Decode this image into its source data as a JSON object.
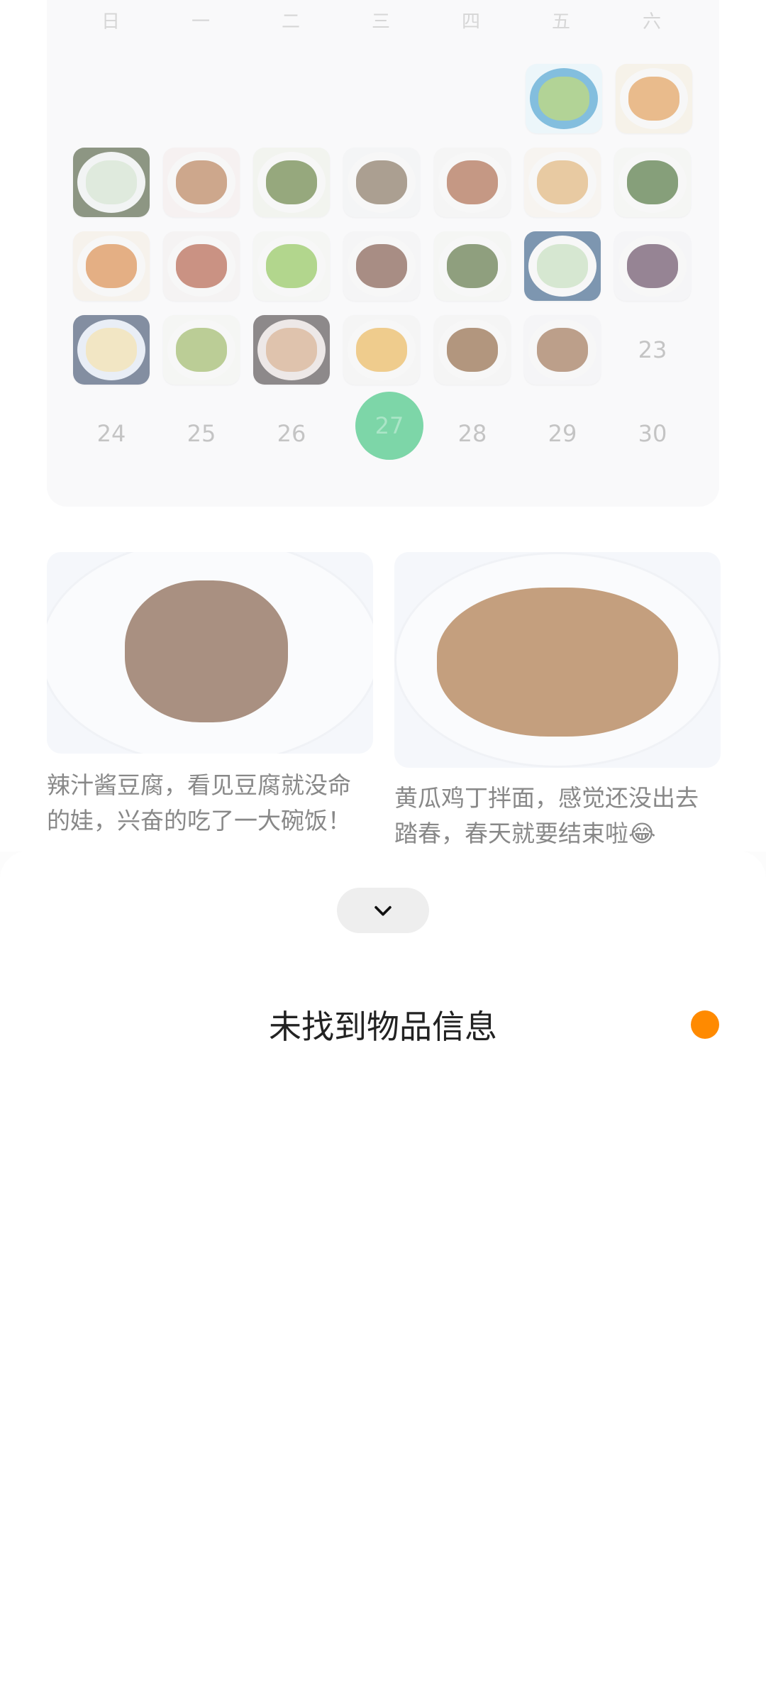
{
  "calendar": {
    "weekdays": [
      "日",
      "一",
      "二",
      "三",
      "四",
      "五",
      "六"
    ],
    "days": {
      "d23": "23",
      "d24": "24",
      "d25": "25",
      "d26": "26",
      "d27": "27",
      "d28": "28",
      "d29": "29",
      "d30": "30"
    },
    "today_color": "#1fb86a"
  },
  "posts": [
    {
      "caption": "辣汁酱豆腐，看见豆腐就没命的娃，兴奋的吃了一大碗饭！"
    },
    {
      "caption": "黄瓜鸡丁拌面，感觉还没出去踏春，春天就要结束啦😂"
    }
  ],
  "sheet": {
    "collapse_icon": "chevron-down-icon",
    "message": "未找到物品信息",
    "status_color": "#ff8a00"
  }
}
